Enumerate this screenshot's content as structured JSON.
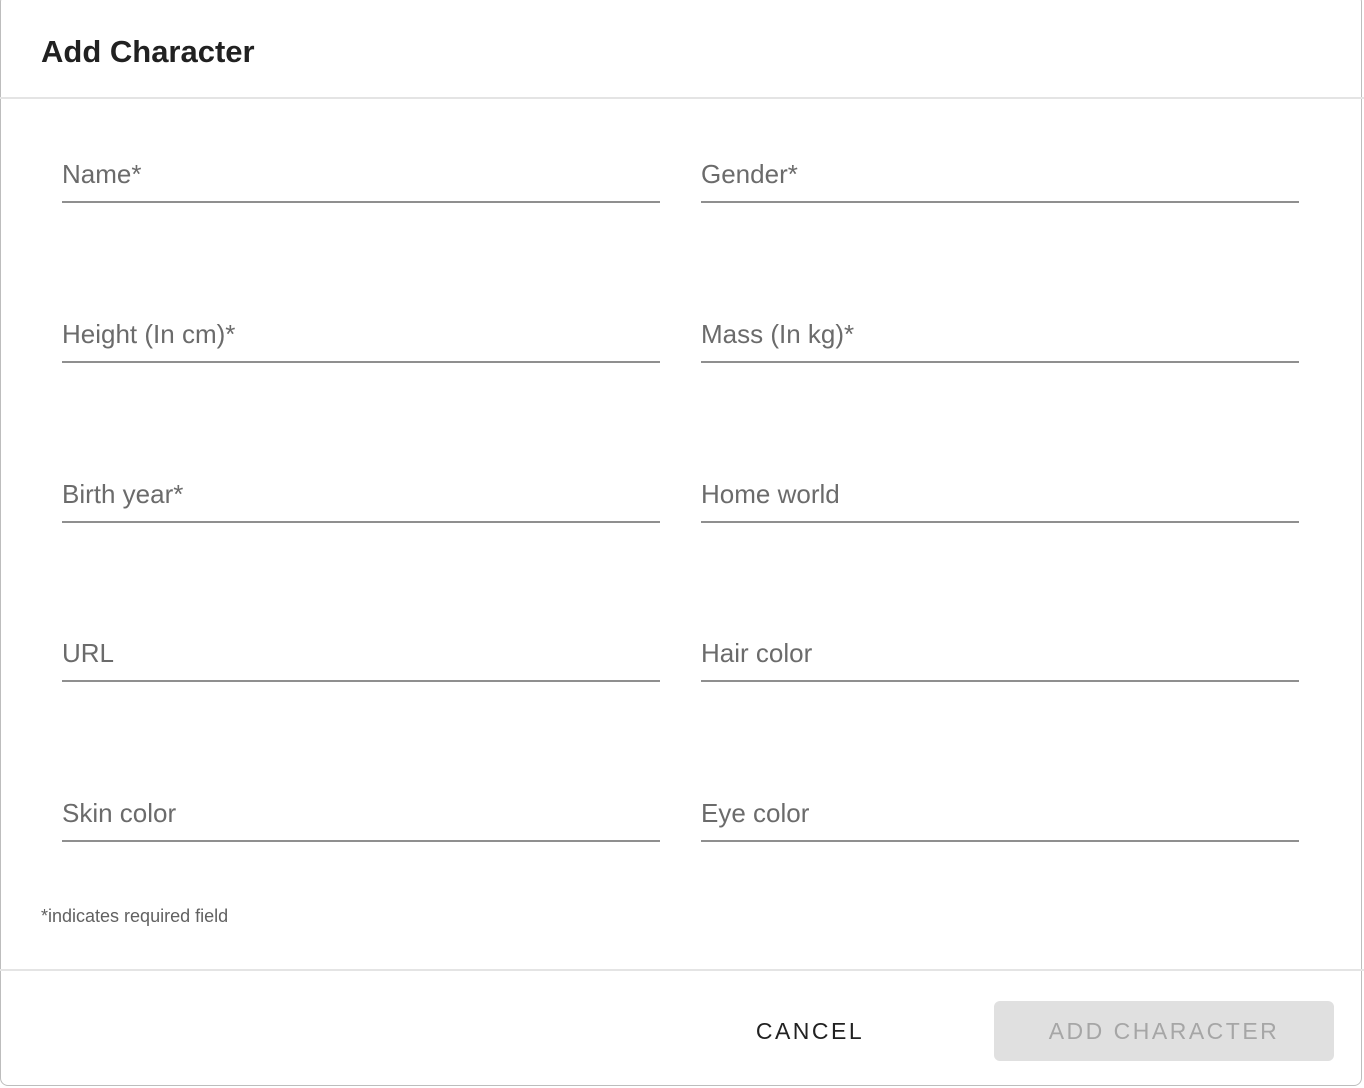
{
  "dialog": {
    "title": "Add Character"
  },
  "fields": [
    {
      "label": "Name*",
      "value": ""
    },
    {
      "label": "Gender*",
      "value": ""
    },
    {
      "label": "Height (In cm)*",
      "value": ""
    },
    {
      "label": "Mass (In kg)*",
      "value": ""
    },
    {
      "label": "Birth year*",
      "value": ""
    },
    {
      "label": "Home world",
      "value": ""
    },
    {
      "label": "URL",
      "value": ""
    },
    {
      "label": "Hair color",
      "value": ""
    },
    {
      "label": "Skin color",
      "value": ""
    },
    {
      "label": "Eye color",
      "value": ""
    }
  ],
  "note": "*indicates required field",
  "actions": {
    "cancel": "CANCEL",
    "add": "ADD CHARACTER",
    "add_disabled": true
  }
}
